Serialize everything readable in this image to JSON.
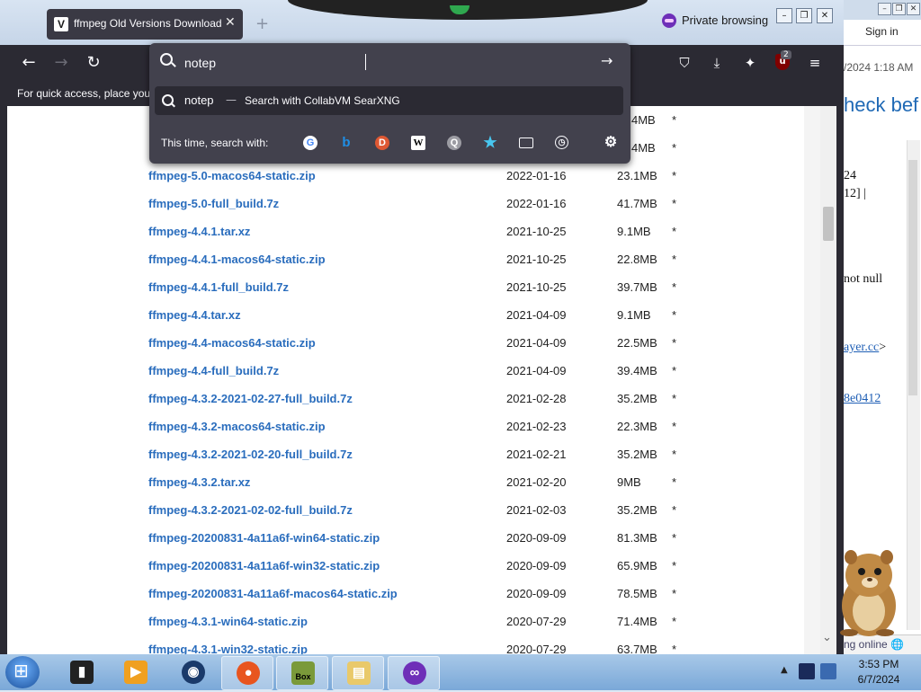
{
  "browser": {
    "tab_title": "ffmpeg Old Versions Download",
    "tab_favicon": "V",
    "new_tab_symbol": "+",
    "private_label": "Private browsing",
    "bookmarks_hint": "For quick access, place your",
    "extension_badge": "2",
    "extension_letter": "u"
  },
  "urlbar": {
    "value": "notep",
    "suggestion_query": "notep",
    "suggestion_separator": "—",
    "suggestion_desc": "Search with CollabVM SearXNG",
    "this_time_label": "This time, search with:",
    "engines": [
      "google-icon",
      "bing-icon",
      "duckduckgo-icon",
      "wikipedia-icon",
      "searxng-icon",
      "bookmarks-star-icon",
      "tabs-icon",
      "history-icon",
      "settings-gear-icon"
    ],
    "engine_glyphs": {
      "google": "G",
      "bing": "b",
      "ddg": "D",
      "wiki": "W",
      "sx": "Q",
      "star": "★",
      "hist": "◷",
      "gear": "⚙"
    }
  },
  "files": {
    "partial_rows": [
      {
        "size": "4MB",
        "star": "*"
      },
      {
        "size": "4MB",
        "star": "*"
      }
    ],
    "rows": [
      {
        "name": "ffmpeg-5.0-macos64-static.zip",
        "date": "2022-01-16",
        "size": "23.1MB",
        "star": "*"
      },
      {
        "name": "ffmpeg-5.0-full_build.7z",
        "date": "2022-01-16",
        "size": "41.7MB",
        "star": "*"
      },
      {
        "name": "ffmpeg-4.4.1.tar.xz",
        "date": "2021-10-25",
        "size": "9.1MB",
        "star": "*"
      },
      {
        "name": "ffmpeg-4.4.1-macos64-static.zip",
        "date": "2021-10-25",
        "size": "22.8MB",
        "star": "*"
      },
      {
        "name": "ffmpeg-4.4.1-full_build.7z",
        "date": "2021-10-25",
        "size": "39.7MB",
        "star": "*"
      },
      {
        "name": "ffmpeg-4.4.tar.xz",
        "date": "2021-04-09",
        "size": "9.1MB",
        "star": "*"
      },
      {
        "name": "ffmpeg-4.4-macos64-static.zip",
        "date": "2021-04-09",
        "size": "22.5MB",
        "star": "*"
      },
      {
        "name": "ffmpeg-4.4-full_build.7z",
        "date": "2021-04-09",
        "size": "39.4MB",
        "star": "*"
      },
      {
        "name": "ffmpeg-4.3.2-2021-02-27-full_build.7z",
        "date": "2021-02-28",
        "size": "35.2MB",
        "star": "*"
      },
      {
        "name": "ffmpeg-4.3.2-macos64-static.zip",
        "date": "2021-02-23",
        "size": "22.3MB",
        "star": "*"
      },
      {
        "name": "ffmpeg-4.3.2-2021-02-20-full_build.7z",
        "date": "2021-02-21",
        "size": "35.2MB",
        "star": "*"
      },
      {
        "name": "ffmpeg-4.3.2.tar.xz",
        "date": "2021-02-20",
        "size": "9MB",
        "star": "*"
      },
      {
        "name": "ffmpeg-4.3.2-2021-02-02-full_build.7z",
        "date": "2021-02-03",
        "size": "35.2MB",
        "star": "*"
      },
      {
        "name": "ffmpeg-20200831-4a11a6f-win64-static.zip",
        "date": "2020-09-09",
        "size": "81.3MB",
        "star": "*"
      },
      {
        "name": "ffmpeg-20200831-4a11a6f-win32-static.zip",
        "date": "2020-09-09",
        "size": "65.9MB",
        "star": "*"
      },
      {
        "name": "ffmpeg-20200831-4a11a6f-macos64-static.zip",
        "date": "2020-09-09",
        "size": "78.5MB",
        "star": "*"
      },
      {
        "name": "ffmpeg-4.3.1-win64-static.zip",
        "date": "2020-07-29",
        "size": "71.4MB",
        "star": "*"
      },
      {
        "name": "ffmpeg-4.3.1-win32-static.zip",
        "date": "2020-07-29",
        "size": "63.7MB",
        "star": "*"
      }
    ]
  },
  "background_window": {
    "sign_in": "Sign in",
    "stamp": "/2024 1:18 AM",
    "heading": "heck bef",
    "text_1": "24",
    "text_2": "12] |",
    "text_3": "not null",
    "link_1": "ayer.cc",
    "link_1_suffix": ">",
    "link_2": "8e0412",
    "status": "ng online"
  },
  "taskbar": {
    "time": "3:53 PM",
    "date": "6/7/2024",
    "box_label": "Box"
  }
}
